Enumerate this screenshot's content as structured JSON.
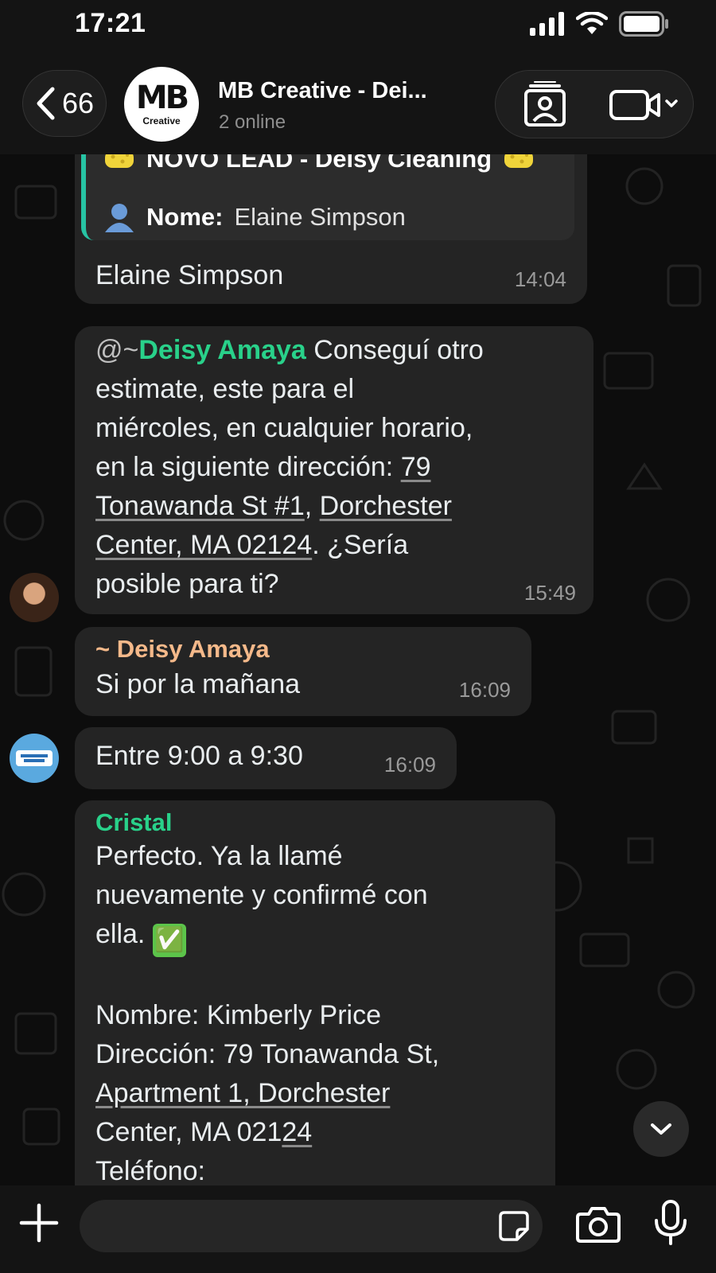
{
  "status_bar": {
    "time": "17:21"
  },
  "header": {
    "back_count": "66",
    "avatar_logo": "MB",
    "avatar_logo_sub": "Creative",
    "title": "MB Creative - Dei...",
    "subtitle": "2 online"
  },
  "messages": {
    "m1": {
      "quote_line1": "NOVO LEAD - Deisy Cleaning",
      "quote_label": "Nome:",
      "quote_value": "Elaine Simpson",
      "text": "Elaine Simpson",
      "time": "14:04"
    },
    "m2": {
      "mention_prefix": "@~",
      "mention": "Deisy Amaya",
      "text_a": " Conseguí otro",
      "text_b": "estimate, este para el",
      "text_c": "miércoles, en cualquier horario,",
      "text_d": "en la siguiente dirección: ",
      "addr1": "79",
      "addr2": "Tonawanda St #1",
      "addr_sep": ", ",
      "addr3": "Dorchester",
      "addr4": "Center, MA 02124",
      "text_e": ". ¿Sería",
      "text_f": "posible para ti?",
      "time": "15:49"
    },
    "m3": {
      "sender": "~ Deisy Amaya",
      "text": "Si por la mañana",
      "time": "16:09"
    },
    "m4": {
      "text": "Entre 9:00 a 9:30",
      "time": "16:09"
    },
    "m5": {
      "sender": "Cristal",
      "line1": "Perfecto. Ya la llamé",
      "line2": "nuevamente y confirmé con",
      "line3": "ella. ",
      "check_emoji": "✅",
      "line4": "Nombre: Kimberly Price",
      "line5": "Dirección: 79 Tonawanda St,",
      "line6": "Apartment 1, Dorchester",
      "line7a": "Center, MA 021",
      "line7b": "24",
      "line8": "Teléfono:"
    }
  },
  "colors": {
    "mention_green": "#29d18a",
    "sender_orange": "#f5b98a",
    "quote_bar": "#27c4a4",
    "bubble": "#242424"
  },
  "icons": [
    "back-chevron-icon",
    "contact-card-icon",
    "video-call-icon",
    "chevron-down-icon",
    "plus-icon",
    "sticker-icon",
    "camera-icon",
    "microphone-icon",
    "sponge-emoji-icon",
    "person-emoji-icon"
  ]
}
